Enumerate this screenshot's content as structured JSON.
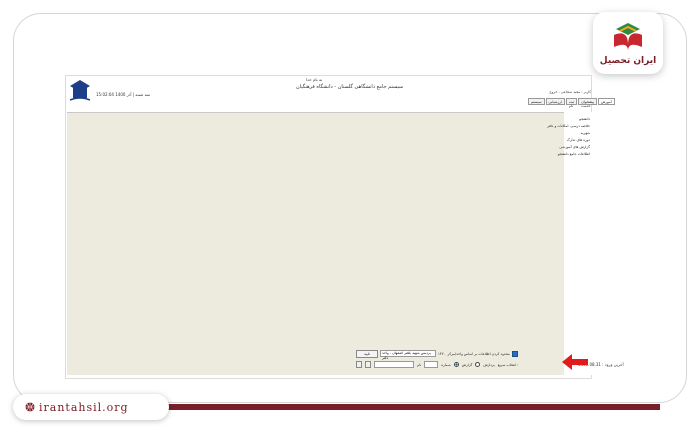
{
  "brand": {
    "name": "ایران تحصیل",
    "url": "irantahsil.org"
  },
  "header": {
    "basm": "به نام خدا",
    "title": "سیستم جامع دانشگاهی گلستان - دانشگاه فرهنگیان",
    "time": "15:02:04  سه شنبه | آذر 1400"
  },
  "menu": {
    "top": "کاربر : مجید شجاعی - خروج"
  },
  "tabs": [
    "آموزش",
    "پیشخوان خدمت",
    "ثبت نام",
    "ارزشیابی",
    "سیستم"
  ],
  "nav": [
    "دانشجو",
    "خلاصه درسی، امکانات و دفتر",
    "شهریه",
    "دوره های تدارک",
    "گزارش های آموزشی",
    "اطلاعات جامع دانشجو"
  ],
  "bottom": {
    "checkbox_label": "محدود کردن اطلاعات بر اساس واحد/مرکز",
    "code": "۱۴۲۰",
    "unit": "پردیس شهید باهنر اصفهان - واحد دکتر",
    "confirm": "تایید",
    "select_label": "انتخاب سریع :",
    "radio_a": "گزارش",
    "radio_b": "پردازش",
    "number_label": "شماره",
    "name_label": "نام"
  },
  "last_login": "آخرین ورود : 1400.08.31"
}
